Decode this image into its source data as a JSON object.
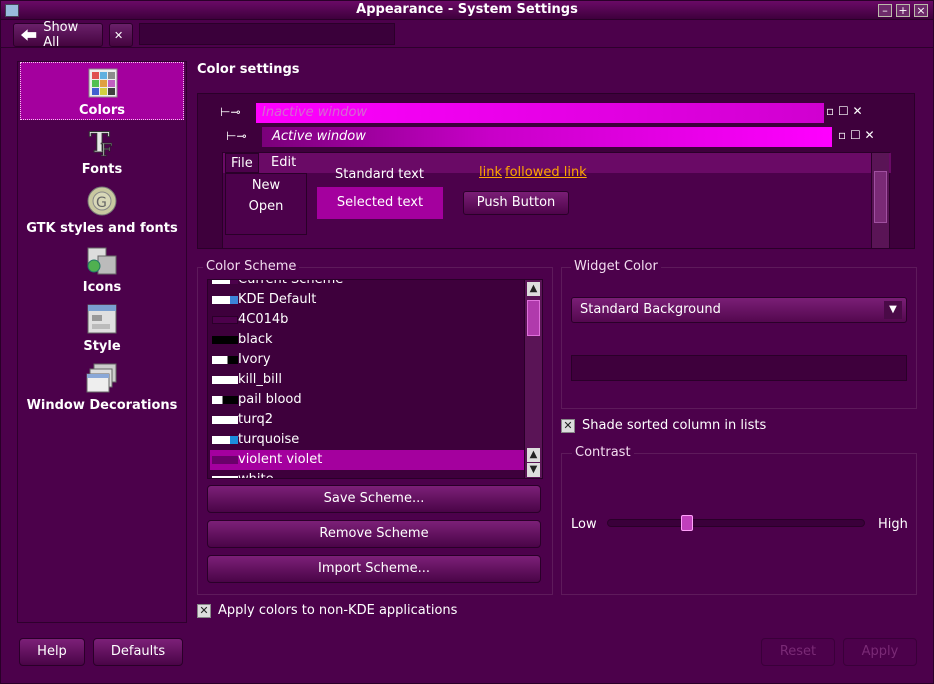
{
  "window": {
    "title": "Appearance - System Settings",
    "controls": [
      "–",
      "+",
      "×"
    ]
  },
  "toolbar": {
    "show_all_label": "Show All",
    "clear_label": "✕",
    "search_placeholder": ""
  },
  "sidebar": {
    "items": [
      {
        "label": "Colors",
        "icon": "colors-icon",
        "active": true
      },
      {
        "label": "Fonts",
        "icon": "fonts-icon"
      },
      {
        "label": "GTK styles and fonts",
        "icon": "gtk-icon"
      },
      {
        "label": "Icons",
        "icon": "icons-icon"
      },
      {
        "label": "Style",
        "icon": "style-icon"
      },
      {
        "label": "Window Decorations",
        "icon": "window-decorations-icon"
      }
    ]
  },
  "main": {
    "section_title": "Color settings",
    "preview": {
      "inactive_window": "Inactive window",
      "active_window": "Active window",
      "menu": [
        "File",
        "Edit"
      ],
      "file_menu_items": [
        "New",
        "Open"
      ],
      "standard_text": "Standard text",
      "selected_text": "Selected text",
      "link": "link",
      "followed_link": "followed link",
      "push_button": "Push Button"
    },
    "color_scheme": {
      "label": "Color Scheme",
      "items": [
        {
          "name": "Current Scheme",
          "swatch": [
            "#ffffff",
            "#4c014b"
          ]
        },
        {
          "name": "KDE Default",
          "swatch": [
            "#ffffff",
            "#3c84d8"
          ]
        },
        {
          "name": "4C014b",
          "swatch": [
            "#4c014b",
            "#4c014b"
          ]
        },
        {
          "name": "black",
          "swatch": [
            "#000000",
            "#000000"
          ]
        },
        {
          "name": "Ivory",
          "swatch": [
            "#ffffff",
            "#000000"
          ]
        },
        {
          "name": "kill_bill",
          "swatch": [
            "#ffffff",
            "#ffffff"
          ]
        },
        {
          "name": "pail blood",
          "swatch": [
            "#ffffff",
            "#000000"
          ]
        },
        {
          "name": "turq2",
          "swatch": [
            "#ffffff",
            "#ffffff"
          ]
        },
        {
          "name": "turquoise",
          "swatch": [
            "#ffffff",
            "#1c8fdc"
          ]
        },
        {
          "name": "violent violet",
          "swatch": [
            "#6a006a",
            "#6a006a"
          ],
          "selected": true
        },
        {
          "name": "white",
          "swatch": [
            "#ffffff",
            "#ffffff"
          ]
        }
      ],
      "save_button": "Save Scheme...",
      "remove_button": "Remove Scheme",
      "import_button": "Import Scheme..."
    },
    "widget_color": {
      "label": "Widget Color",
      "selected": "Standard Background"
    },
    "shade_sorted_label": "Shade sorted column in lists",
    "shade_sorted_checked": true,
    "contrast": {
      "label": "Contrast",
      "low": "Low",
      "high": "High",
      "value_fraction": 0.3
    },
    "apply_colors_label": "Apply colors to non-KDE applications",
    "apply_colors_checked": true
  },
  "footer": {
    "help": "Help",
    "defaults": "Defaults",
    "reset": "Reset",
    "apply": "Apply"
  },
  "colors": {
    "accent": "#a4009e",
    "background": "#4c014b",
    "link": "#ffa800"
  }
}
